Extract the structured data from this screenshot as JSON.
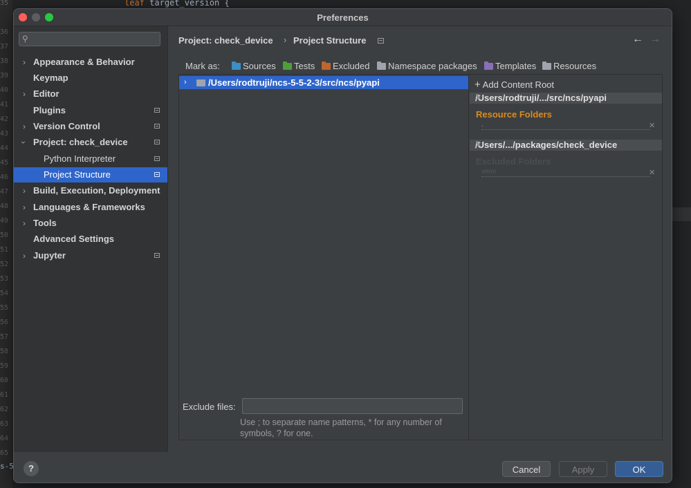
{
  "background": {
    "line_numbers": [
      "35",
      "36",
      "37",
      "38",
      "39",
      "40",
      "41",
      "42",
      "43",
      "44",
      "45",
      "46",
      "47",
      "48",
      "49",
      "50",
      "51",
      "52",
      "53",
      "54",
      "55",
      "56",
      "57",
      "58",
      "59",
      "60",
      "61",
      "62",
      "63",
      "64",
      "65"
    ],
    "code_keyword": "leaf",
    "code_ident": "target_version {",
    "left_fragment": "s-5"
  },
  "window": {
    "title": "Preferences"
  },
  "sidebar": {
    "search_placeholder": "",
    "items": [
      {
        "label": "Appearance & Behavior"
      },
      {
        "label": "Keymap"
      },
      {
        "label": "Editor"
      },
      {
        "label": "Plugins"
      },
      {
        "label": "Version Control"
      },
      {
        "label": "Project: check_device"
      },
      {
        "label": "Python Interpreter"
      },
      {
        "label": "Project Structure"
      },
      {
        "label": "Build, Execution, Deployment"
      },
      {
        "label": "Languages & Frameworks"
      },
      {
        "label": "Tools"
      },
      {
        "label": "Advanced Settings"
      },
      {
        "label": "Jupyter"
      }
    ]
  },
  "breadcrumb": {
    "project": "Project: check_device",
    "page": "Project Structure"
  },
  "mark_as": {
    "label": "Mark as:",
    "sources": "Sources",
    "tests": "Tests",
    "excluded": "Excluded",
    "namespace": "Namespace packages",
    "templates": "Templates",
    "resources": "Resources",
    "colors": {
      "sources": "#3a8fc7",
      "tests": "#4f9e3a",
      "excluded": "#c0652b",
      "namespace": "#9fa4ad",
      "templates": "#8a6fb8",
      "resources": "#9fa4ad"
    }
  },
  "tree": {
    "root_path": "/Users/rodtruji/ncs-5-5-2-3/src/ncs/pyapi"
  },
  "exclude": {
    "label": "Exclude files:",
    "value": "",
    "hint": "Use ; to separate name patterns, * for any number of symbols, ? for one."
  },
  "content_roots": {
    "add_label": "Add Content Root",
    "roots": [
      {
        "path": "/Users/rodtruji/.../src/ncs/pyapi",
        "section": "Resource Folders",
        "section_color": "#d88b1f",
        "entry": "."
      },
      {
        "path": "/Users/.../packages/check_device",
        "section": "Excluded Folders",
        "section_color": "#4a4d50",
        "entry": "venv"
      }
    ]
  },
  "buttons": {
    "help": "?",
    "cancel": "Cancel",
    "apply": "Apply",
    "ok": "OK"
  }
}
